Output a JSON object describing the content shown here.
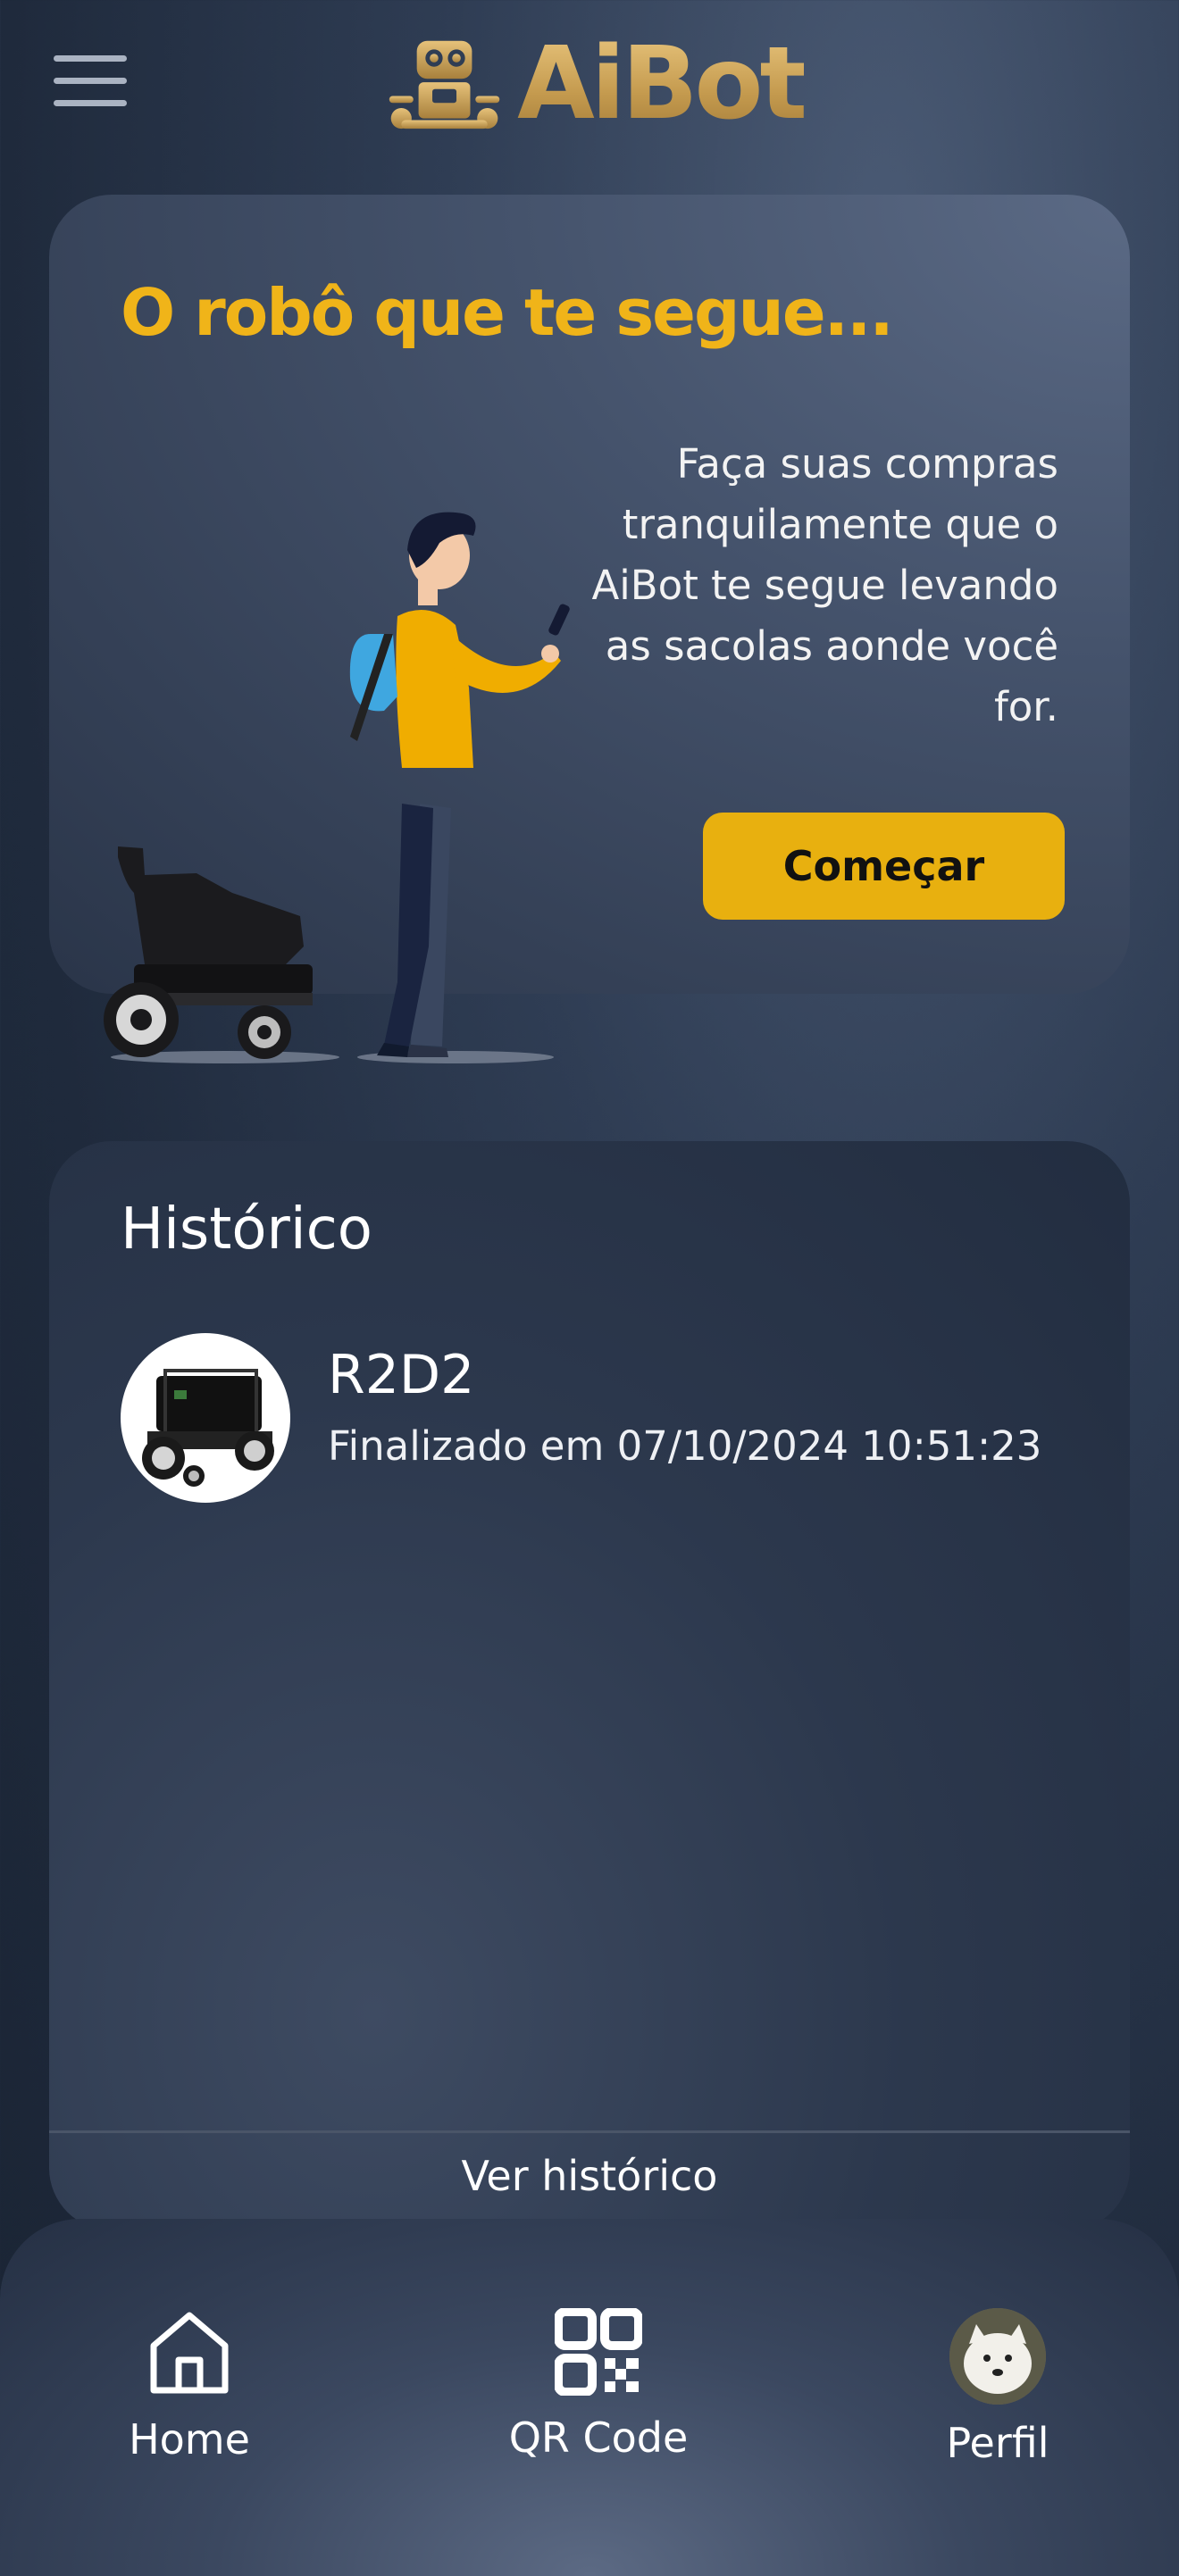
{
  "header": {
    "app_name": "AiBot",
    "menu_icon": "hamburger-menu-icon",
    "logo_icon": "robot-logo-icon"
  },
  "hero": {
    "title": "O robô que te segue...",
    "description": "Faça suas compras tranquilamente que o AiBot te segue levando as sacolas aonde você for.",
    "cta_label": "Começar"
  },
  "history": {
    "title": "Histórico",
    "items": [
      {
        "name": "R2D2",
        "status": "Finalizado em 07/10/2024 10:51:23",
        "icon": "robot-cart-thumbnail"
      }
    ],
    "link_label": "Ver histórico"
  },
  "nav": {
    "home_label": "Home",
    "qr_label": "QR Code",
    "profile_label": "Perfil"
  },
  "colors": {
    "accent": "#e8b00f",
    "title": "#f0b419",
    "logo_gold": "#c49a4e",
    "background": "#1f2a3c"
  }
}
